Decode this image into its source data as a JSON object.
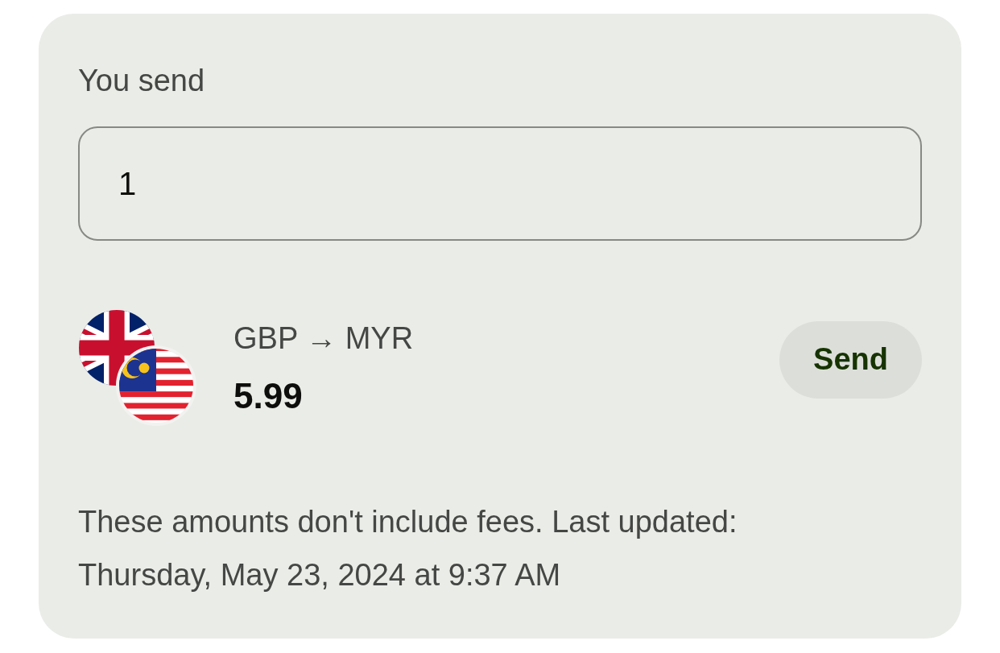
{
  "send": {
    "label": "You send",
    "input": {
      "value": "1"
    }
  },
  "conversion": {
    "pair": "GBP → MYR",
    "rate": "5.99",
    "button": "Send"
  },
  "footer_note": "These amounts don't include fees. Last updated: Thursday, May 23, 2024 at 9:37 AM"
}
